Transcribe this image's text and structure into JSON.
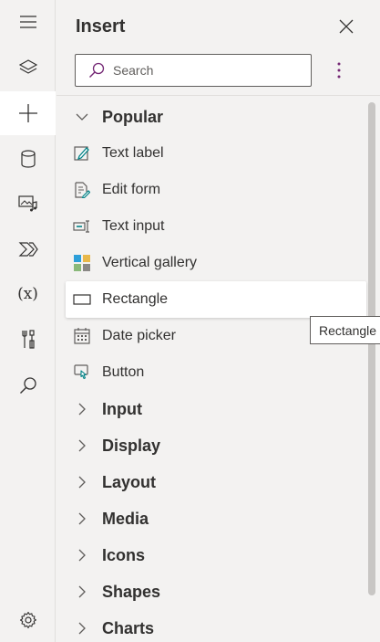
{
  "panel": {
    "title": "Insert"
  },
  "search": {
    "placeholder": "Search"
  },
  "rail": {
    "items": [
      {
        "icon": "hamburger-menu-icon"
      },
      {
        "icon": "layers-icon"
      },
      {
        "icon": "plus-icon",
        "active": true
      },
      {
        "icon": "database-icon"
      },
      {
        "icon": "media-icon"
      },
      {
        "icon": "power-automate-icon"
      },
      {
        "icon": "variables-icon",
        "label": "(x)"
      },
      {
        "icon": "advanced-tools-icon"
      },
      {
        "icon": "search-icon"
      },
      {
        "icon": "settings-icon"
      }
    ]
  },
  "categories": {
    "popular": "Popular",
    "input": "Input",
    "display": "Display",
    "layout": "Layout",
    "media": "Media",
    "icons": "Icons",
    "shapes": "Shapes",
    "charts": "Charts"
  },
  "items": {
    "text_label": "Text label",
    "edit_form": "Edit form",
    "text_input": "Text input",
    "vertical_gallery": "Vertical gallery",
    "rectangle": "Rectangle",
    "date_picker": "Date picker",
    "button": "Button"
  },
  "tooltip": {
    "text": "Rectangle"
  },
  "colors": {
    "accent": "#742774",
    "teal": "#038387",
    "background": "#f3f2f1",
    "border": "#605e5c"
  }
}
